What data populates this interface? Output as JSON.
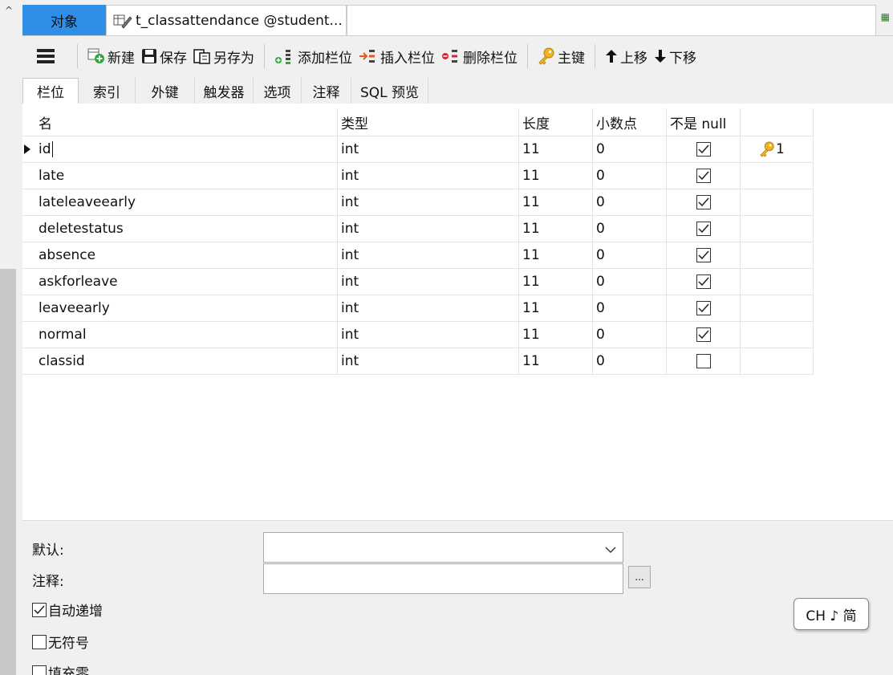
{
  "tabs": {
    "objects_label": "对象",
    "table_label": "t_classattendance @student..."
  },
  "toolbar": {
    "new": "新建",
    "save": "保存",
    "save_as": "另存为",
    "add_field": "添加栏位",
    "insert_field": "插入栏位",
    "delete_field": "删除栏位",
    "primary_key": "主键",
    "move_up": "上移",
    "move_down": "下移"
  },
  "subtabs": [
    "栏位",
    "索引",
    "外键",
    "触发器",
    "选项",
    "注释",
    "SQL 预览"
  ],
  "grid": {
    "headers": {
      "name": "名",
      "type": "类型",
      "length": "长度",
      "decimals": "小数点",
      "not_null": "不是 null",
      "key": ""
    },
    "rows": [
      {
        "name": "id",
        "type": "int",
        "length": "11",
        "decimals": "0",
        "not_null": true,
        "key": "1"
      },
      {
        "name": "late",
        "type": "int",
        "length": "11",
        "decimals": "0",
        "not_null": true,
        "key": ""
      },
      {
        "name": "lateleaveearly",
        "type": "int",
        "length": "11",
        "decimals": "0",
        "not_null": true,
        "key": ""
      },
      {
        "name": "deletestatus",
        "type": "int",
        "length": "11",
        "decimals": "0",
        "not_null": true,
        "key": ""
      },
      {
        "name": "absence",
        "type": "int",
        "length": "11",
        "decimals": "0",
        "not_null": true,
        "key": ""
      },
      {
        "name": "askforleave",
        "type": "int",
        "length": "11",
        "decimals": "0",
        "not_null": true,
        "key": ""
      },
      {
        "name": "leaveearly",
        "type": "int",
        "length": "11",
        "decimals": "0",
        "not_null": true,
        "key": ""
      },
      {
        "name": "normal",
        "type": "int",
        "length": "11",
        "decimals": "0",
        "not_null": true,
        "key": ""
      },
      {
        "name": "classid",
        "type": "int",
        "length": "11",
        "decimals": "0",
        "not_null": false,
        "key": ""
      }
    ]
  },
  "properties": {
    "default_label": "默认:",
    "default_value": "",
    "comment_label": "注释:",
    "comment_value": "",
    "ellipsis": "...",
    "auto_increment_label": "自动递增",
    "auto_increment": true,
    "unsigned_label": "无符号",
    "unsigned": false,
    "zerofill_label": "填充零",
    "zerofill": false
  },
  "ime": {
    "label": "CH ♪ 简"
  },
  "colors": {
    "accent_tab": "#2f8ee6",
    "toolbar_bg": "#f0f0f0"
  }
}
